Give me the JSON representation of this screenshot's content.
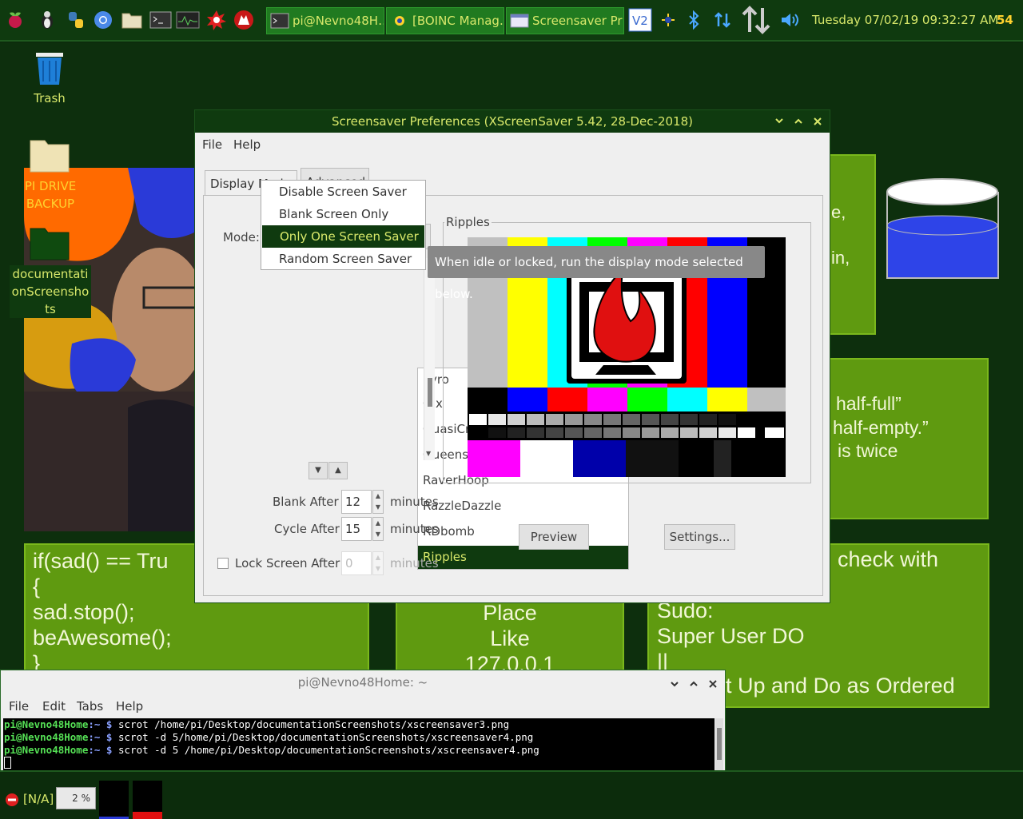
{
  "top_panel": {
    "launchers": [
      "raspberry-menu-icon",
      "penguin-icon",
      "python-icon",
      "chromium-icon",
      "file-manager-icon",
      "terminal-icon",
      "system-monitor-icon",
      "burst-icon",
      "wolf-icon"
    ],
    "tasks": [
      {
        "label": "pi@Nevno48H…",
        "icon": "terminal-icon"
      },
      {
        "label": "[BOINC Manag…",
        "icon": "boinc-icon"
      },
      {
        "label": "Screensaver Pr…",
        "icon": "window-icon"
      }
    ],
    "tray": [
      "vnc-icon",
      "boinc-tray-icon",
      "bluetooth-icon",
      "network-icon",
      "updown-icon",
      "volume-icon"
    ],
    "clock": "Tuesday 07/02/19 09:32:27 AM",
    "cpu": "54"
  },
  "desktop": {
    "icons": [
      {
        "label": "Trash"
      },
      {
        "label": "PI DRIVE BACKUP"
      },
      {
        "label": "documentationScreenshots"
      }
    ],
    "wallpaper_text": {
      "code": [
        "if(sad() == Tru",
        "{",
        "sad.stop();",
        "beAwesome();",
        "}"
      ],
      "place": [
        "Place",
        "Like",
        "127.0.0.1"
      ],
      "sudo": [
        "check with",
        "Sudo:",
        "Super User DO",
        "||",
        "t Up and Do as Ordered"
      ],
      "glass_top": [
        "e,",
        "in,"
      ],
      "glass_mid": [
        "half-full”",
        "half-empty.”",
        "is twice"
      ]
    }
  },
  "dialog": {
    "title": "Screensaver Preferences  (XScreenSaver 5.42, 28-Dec-2018)",
    "menu": [
      "File",
      "Help"
    ],
    "tabs": [
      "Display Modes",
      "Advanced"
    ],
    "mode_label": "Mode:",
    "mode_options": [
      "Disable Screen Saver",
      "Blank Screen Only",
      "Only One Screen Saver",
      "Random Screen Saver"
    ],
    "mode_selected": "Only One Screen Saver",
    "tooltip": "When idle or locked, run the display mode selected below.",
    "list": [
      "Pyro",
      "Qix",
      "QuasiCrystal",
      "Queens",
      "RaverHoop",
      "RazzleDazzle",
      "RDbomb",
      "Ripples"
    ],
    "list_selected": "Ripples",
    "preview_frame_label": "Ripples",
    "blank_after_label": "Blank After",
    "blank_after": "12",
    "blank_unit": "minutes",
    "cycle_after_label": "Cycle After",
    "cycle_after": "15",
    "cycle_unit": "minutes",
    "lock_label": "Lock Screen After",
    "lock_after": "0",
    "lock_unit": "minutes",
    "preview_button": "Preview",
    "settings_button": "Settings...",
    "title_buttons": [
      "chevron-down-icon",
      "chevron-up-icon",
      "close-icon"
    ]
  },
  "terminal": {
    "title": "pi@Nevno48Home: ~",
    "menu": [
      "File",
      "Edit",
      "Tabs",
      "Help"
    ],
    "prompt_user": "pi@Nevno48Home",
    "prompt_sep": ":~ $",
    "lines": [
      "scrot /home/pi/Desktop/documentationScreenshots/xscreensaver3.png",
      "scrot -d 5/home/pi/Desktop/documentationScreenshots/xscreensaver4.png",
      "scrot -d 5 /home/pi/Desktop/documentationScreenshots/xscreensaver4.png"
    ]
  },
  "bottom_panel": {
    "status": "[N/A]",
    "percent": "2 %",
    "gauges": [
      0.05,
      0.2
    ]
  },
  "colors": {
    "panel": "#0f3a0f",
    "accent": "#d8e86a",
    "highlight": "#0f3a0f",
    "green_box": "#5f9a10"
  }
}
